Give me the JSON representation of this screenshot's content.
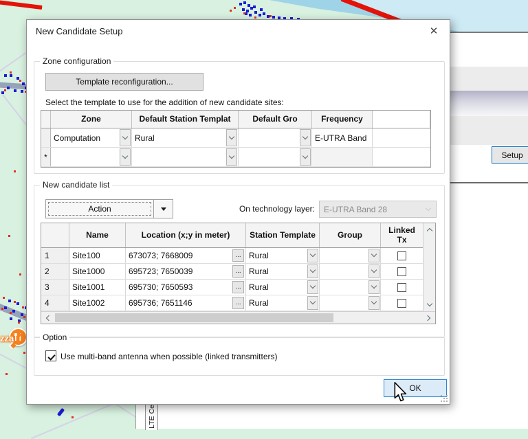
{
  "dialog": {
    "title": "New Candidate Setup",
    "close_glyph": "✕",
    "zone_configuration": {
      "legend": "Zone configuration",
      "template_reconfig_button": "Template reconfiguration...",
      "instruction": "Select the template to use for the addition of new candidate sites:",
      "table": {
        "columns": [
          "",
          "Zone",
          "Default Station Templat",
          "Default Gro",
          "Frequency"
        ],
        "rows": [
          {
            "row_header": "",
            "zone": "Computation",
            "default_station_template": "Rural",
            "default_group": "",
            "frequency": "E-UTRA Band"
          },
          {
            "row_header": "*",
            "zone": "",
            "default_station_template": "",
            "default_group": "",
            "frequency": ""
          }
        ]
      }
    },
    "new_candidate_list": {
      "legend": "New candidate list",
      "action_button": "Action",
      "technology_label": "On technology layer:",
      "technology_value": "E-UTRA Band 28",
      "browse_label": "...",
      "table": {
        "columns": [
          "",
          "Name",
          "Location (x;y in meter)",
          "Station Template",
          "Group",
          "Linked Tx"
        ],
        "rows": [
          {
            "num": "1",
            "name": "Site100",
            "location": "673073; 7668009",
            "station_template": "Rural",
            "group": "",
            "linked_tx": false
          },
          {
            "num": "2",
            "name": "Site1000",
            "location": "695723; 7650039",
            "station_template": "Rural",
            "group": "",
            "linked_tx": false
          },
          {
            "num": "3",
            "name": "Site1001",
            "location": "695730; 7650593",
            "station_template": "Rural",
            "group": "",
            "linked_tx": false
          },
          {
            "num": "4",
            "name": "Site1002",
            "location": "695736; 7651146",
            "station_template": "Rural",
            "group": "",
            "linked_tx": false
          }
        ]
      }
    },
    "option": {
      "legend": "Option",
      "checkbox_label": "Use multi-band antenna when possible (linked transmitters)",
      "checked": true
    },
    "ok_button": "OK"
  },
  "background_window": {
    "setup_button": "Setup",
    "vertical_tab": "LTE Ce"
  },
  "map": {
    "poi_label": "zza"
  },
  "colors": {
    "accent_blue": "#0b6fc4",
    "ok_hover_fill": "#dcebf8",
    "map_land": "#d8f1e0",
    "map_water": "#9fd4e8",
    "map_red_line": "#e41309",
    "map_blue_dots": "#1b1bd6",
    "poi_orange": "#f5821f"
  }
}
